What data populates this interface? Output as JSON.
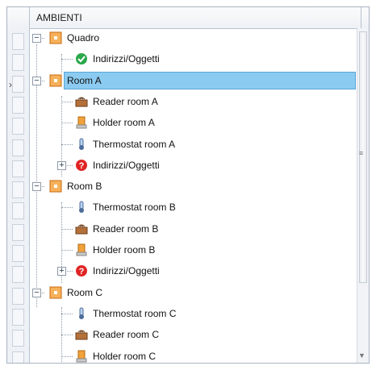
{
  "grid": {
    "header": "AMBIENTI"
  },
  "tree": [
    {
      "label": "Quadro",
      "icon": "room-icon",
      "toggle": "−"
    },
    {
      "label": "Indirizzi/Oggetti",
      "icon": "check-green-icon"
    },
    {
      "label": "Room A",
      "icon": "room-icon",
      "toggle": "−",
      "selected": true
    },
    {
      "label": "Reader room A",
      "icon": "reader-icon"
    },
    {
      "label": "Holder room A",
      "icon": "holder-icon"
    },
    {
      "label": "Thermostat room A",
      "icon": "thermometer-icon"
    },
    {
      "label": "Indirizzi/Oggetti",
      "icon": "question-red-icon",
      "toggle": "+"
    },
    {
      "label": "Room B",
      "icon": "room-icon",
      "toggle": "−"
    },
    {
      "label": "Thermostat room B",
      "icon": "thermometer-icon"
    },
    {
      "label": "Reader room B",
      "icon": "reader-icon"
    },
    {
      "label": "Holder room B",
      "icon": "holder-icon"
    },
    {
      "label": "Indirizzi/Oggetti",
      "icon": "question-red-icon",
      "toggle": "+"
    },
    {
      "label": "Room C",
      "icon": "room-icon",
      "toggle": "−"
    },
    {
      "label": "Thermostat room C",
      "icon": "thermometer-icon"
    },
    {
      "label": "Reader room C",
      "icon": "reader-icon"
    },
    {
      "label": "Holder room C",
      "icon": "holder-icon"
    }
  ],
  "colors": {
    "selection": "#8ccbf1",
    "room_icon": "#e8892b",
    "ok": "#2aa84a",
    "error": "#e02424"
  }
}
